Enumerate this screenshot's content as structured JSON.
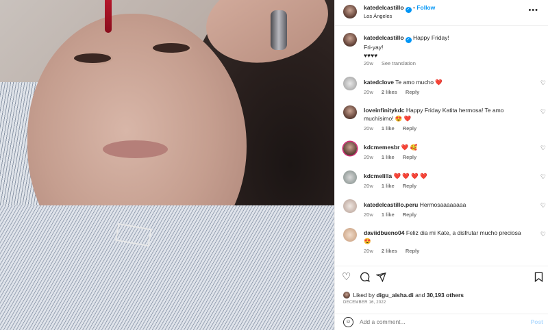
{
  "post": {
    "username": "katedelcastillo",
    "location": "Los Ángeles",
    "follow_label": "Follow",
    "separator": "•",
    "more_icon": "more-horizontal-icon"
  },
  "caption": {
    "username": "katedelcastillo",
    "line1": "Happy Friday!",
    "line2": "Fri-yay!",
    "line3": "♥♥♥♥",
    "time": "20w",
    "see_translation": "See translation"
  },
  "comments": [
    {
      "username": "katedclove",
      "text": "Te amo mucho ❤️",
      "time": "20w",
      "likes": "2 likes",
      "reply": "Reply"
    },
    {
      "username": "loveinfinitykdc",
      "text": "Happy Friday Katita hermosa! Te amo muchísimo! 😍 ❤️",
      "time": "20w",
      "likes": "1 like",
      "reply": "Reply"
    },
    {
      "username": "kdcmemesbr",
      "text": "❤️ 🥰",
      "time": "20w",
      "likes": "1 like",
      "reply": "Reply"
    },
    {
      "username": "kdcmelilla",
      "text": "❤️ ❤️ ❤️ ❤️",
      "time": "20w",
      "likes": "1 like",
      "reply": "Reply"
    },
    {
      "username": "katedelcastillo.peru",
      "text": "Hermosaaaaaaaa",
      "time": "20w",
      "likes": "1 like",
      "reply": "Reply"
    },
    {
      "username": "daviidbueno04",
      "text": "Feliz dia mi Kate, a disfrutar mucho preciosa 😍",
      "time": "20w",
      "likes": "2 likes",
      "reply": "Reply"
    }
  ],
  "footer": {
    "liked_prefix": "Liked by",
    "liked_user": "digu_aisha.di",
    "liked_and": "and",
    "liked_others": "30,193 others",
    "date": "DECEMBER 16, 2022",
    "add_comment_placeholder": "Add a comment...",
    "post_label": "Post"
  },
  "colors": {
    "accent": "#0095f6",
    "heart_red": "#ed4956",
    "muted": "#737373"
  }
}
